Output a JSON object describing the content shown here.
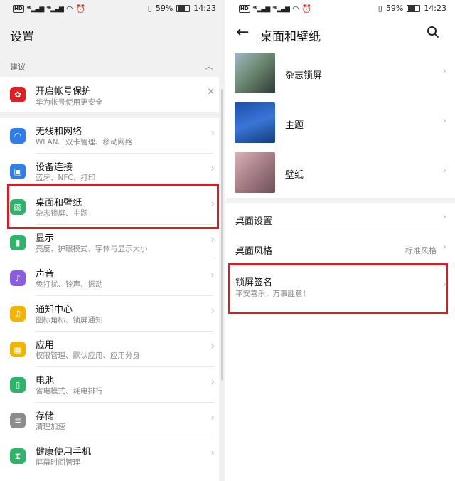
{
  "status": {
    "time": "14:23",
    "battery": "59%",
    "network": "4G"
  },
  "left": {
    "title": "设置",
    "section_label": "建议",
    "suggestion": {
      "title": "开启帐号保护",
      "subtitle": "华为帐号使用更安全"
    },
    "items": [
      {
        "title": "无线和网络",
        "subtitle": "WLAN、双卡管理、移动网络",
        "color": "#2f7de6"
      },
      {
        "title": "设备连接",
        "subtitle": "蓝牙、NFC、打印",
        "color": "#2f7de6"
      },
      {
        "title": "桌面和壁纸",
        "subtitle": "杂志锁屏、主题",
        "color": "#2fb36b"
      },
      {
        "title": "显示",
        "subtitle": "亮度、护眼模式、字体与显示大小",
        "color": "#2fb36b"
      },
      {
        "title": "声音",
        "subtitle": "免打扰、铃声、振动",
        "color": "#8a5de0"
      },
      {
        "title": "通知中心",
        "subtitle": "图标角标、锁屏通知",
        "color": "#f2b400"
      },
      {
        "title": "应用",
        "subtitle": "权限管理、默认应用、应用分身",
        "color": "#f2b400"
      },
      {
        "title": "电池",
        "subtitle": "省电模式、耗电排行",
        "color": "#2fb36b"
      },
      {
        "title": "存储",
        "subtitle": "清理加速",
        "color": "#8c8c8c"
      },
      {
        "title": "健康使用手机",
        "subtitle": "屏幕时间管理",
        "color": "#2fb36b"
      }
    ]
  },
  "right": {
    "title": "桌面和壁纸",
    "thumb_items": [
      {
        "label": "杂志锁屏"
      },
      {
        "label": "主题"
      },
      {
        "label": "壁纸"
      }
    ],
    "desktop_settings": "桌面设置",
    "desktop_style": {
      "label": "桌面风格",
      "value": "标准风格"
    },
    "lock_signature": {
      "label": "锁屏签名",
      "value": "平安喜乐，万事胜意！"
    }
  },
  "highlight_color": "#d11f2b"
}
